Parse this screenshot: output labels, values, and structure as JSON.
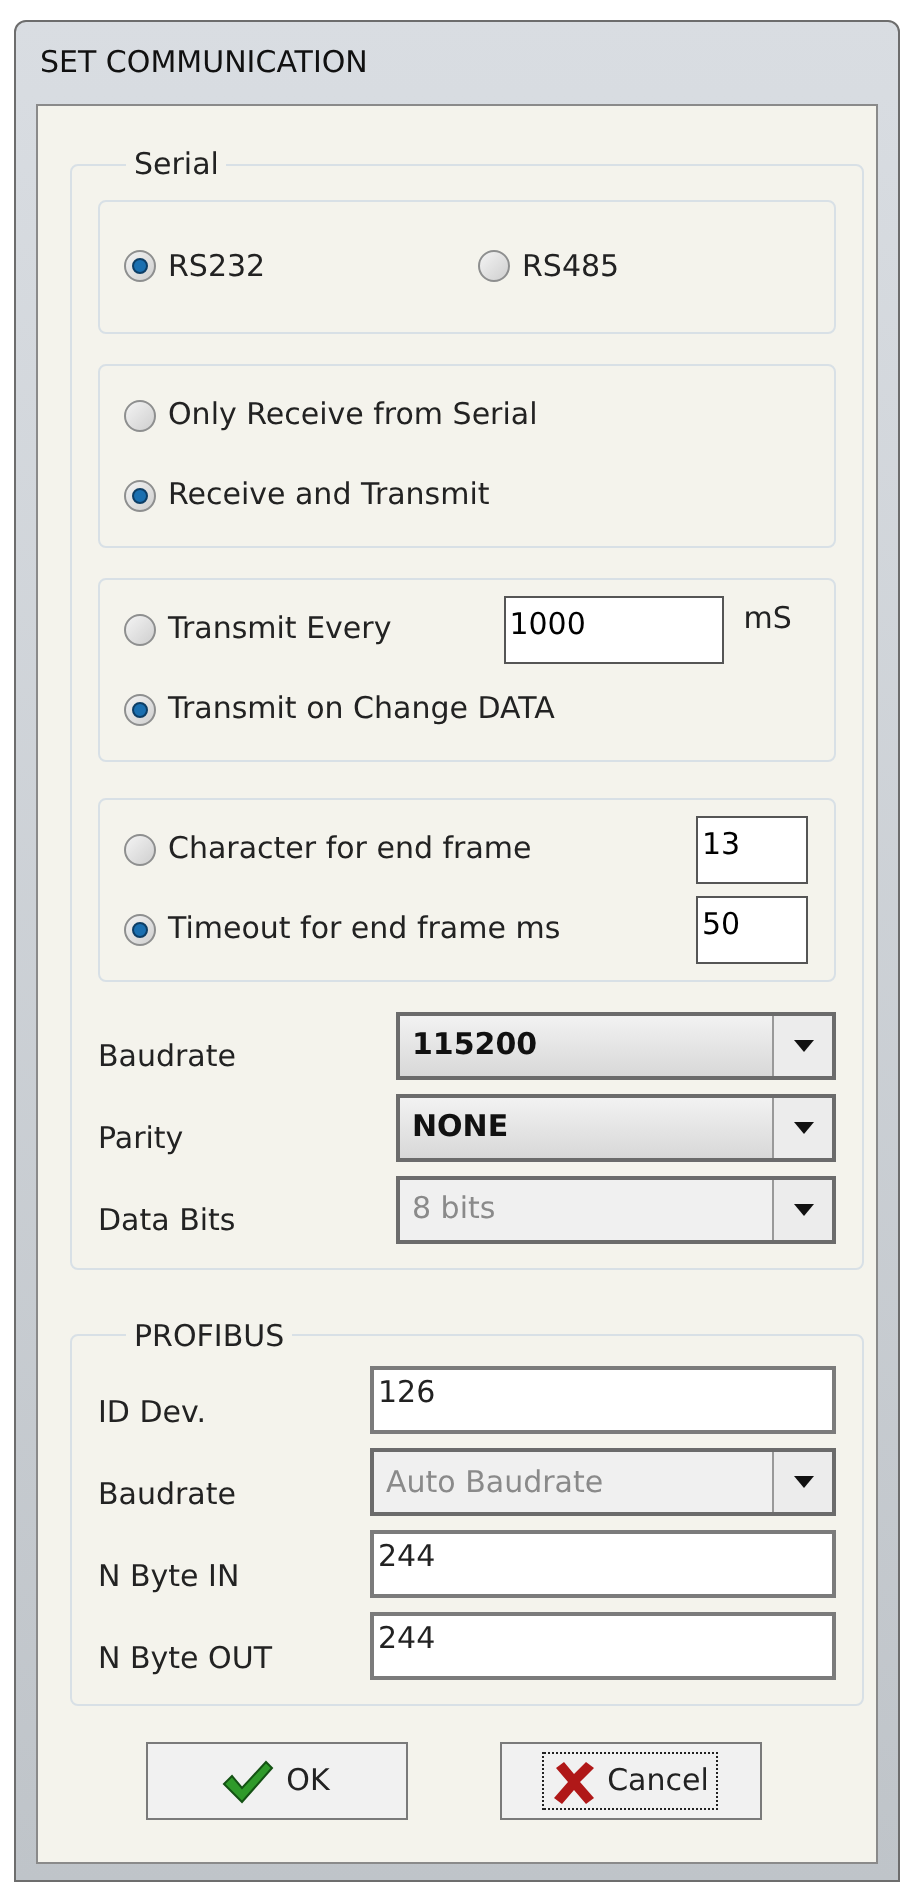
{
  "window": {
    "title": "SET COMMUNICATION"
  },
  "serial": {
    "legend": "Serial",
    "groups": [
      {
        "kind": "row",
        "options": [
          {
            "label": "RS232",
            "selected": true
          },
          {
            "label": "RS485",
            "selected": false
          }
        ]
      },
      {
        "kind": "column",
        "options": [
          {
            "label": "Only Receive from Serial",
            "selected": false
          },
          {
            "label": "Receive and Transmit",
            "selected": true
          }
        ]
      },
      {
        "kind": "column",
        "options": [
          {
            "label": "Transmit Every",
            "selected": false,
            "value": "1000",
            "unit": "mS"
          },
          {
            "label": "Transmit on Change DATA",
            "selected": true
          }
        ]
      },
      {
        "kind": "column",
        "options": [
          {
            "label": "Character for end frame",
            "selected": false,
            "value": "13"
          },
          {
            "label": "Timeout for end frame ms",
            "selected": true,
            "value": "50"
          }
        ]
      }
    ],
    "fields": [
      {
        "label": "Baudrate",
        "kind": "dropdown",
        "value": "115200",
        "disabled": false
      },
      {
        "label": "Parity",
        "kind": "dropdown",
        "value": "NONE",
        "disabled": false
      },
      {
        "label": "Data Bits",
        "kind": "dropdown",
        "value": "8 bits",
        "disabled": true
      }
    ]
  },
  "profibus": {
    "legend": "PROFIBUS",
    "fields": [
      {
        "label": "ID Dev.",
        "kind": "text",
        "value": "126"
      },
      {
        "label": "Baudrate",
        "kind": "dropdown",
        "value": "Auto Baudrate",
        "disabled": true
      },
      {
        "label": "N Byte IN",
        "kind": "text",
        "value": "244"
      },
      {
        "label": "N Byte OUT",
        "kind": "text",
        "value": "244"
      }
    ]
  },
  "buttons": [
    {
      "kind": "ok",
      "label": "OK",
      "focused": false
    },
    {
      "kind": "cancel",
      "label": "Cancel",
      "focused": true
    }
  ]
}
